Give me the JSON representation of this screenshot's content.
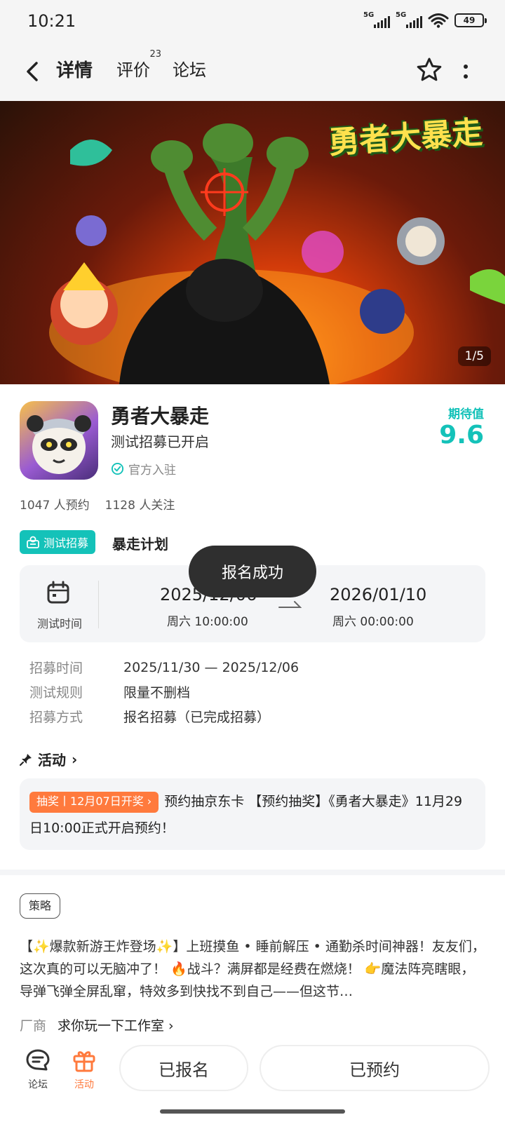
{
  "status_bar": {
    "time": "10:21",
    "sim1": "5G",
    "sim2": "5G",
    "battery": "49"
  },
  "nav": {
    "tab_detail": "详情",
    "tab_review": "评价",
    "review_count": "23",
    "tab_forum": "论坛"
  },
  "banner": {
    "logo_text": "勇者大暴走",
    "counter": "1/5"
  },
  "app": {
    "title": "勇者大暴走",
    "subtitle": "测试招募已开启",
    "verified": "官方入驻",
    "expect_label": "期待值",
    "expect_value": "9.6",
    "reservations": "1047 人预约",
    "followers": "1128 人关注"
  },
  "test": {
    "tag": "测试招募",
    "plan": "暴走计划",
    "time_label": "测试时间",
    "start_date": "2025/12/06",
    "start_day": "周六  10:00:00",
    "end_date": "2026/01/10",
    "end_day": "周六  00:00:00",
    "rows": [
      {
        "key": "招募时间",
        "value": "2025/11/30 — 2025/12/06"
      },
      {
        "key": "测试规则",
        "value": "限量不删档"
      },
      {
        "key": "招募方式",
        "value": "报名招募（已完成招募）"
      }
    ]
  },
  "toast": "报名成功",
  "activity": {
    "header": "活动",
    "badge": "抽奖丨12月07日开奖 ›",
    "text": "预约抽京东卡 【预约抽奖】《勇者大暴走》11月29日10:00正式开启预约！"
  },
  "strategy_tag": "策略",
  "description": "【✨爆款新游王炸登场✨】上班摸鱼 • 睡前解压 • 通勤杀时间神器！友友们，这次真的可以无脑冲了！ 🔥战斗？满屏都是经费在燃烧！ 👉魔法阵亮瞎眼，导弹飞弹全屏乱窜，特效多到快找不到自己——但这节…",
  "vendor": {
    "key": "厂商",
    "value": "求你玩一下工作室 ›"
  },
  "bottom": {
    "forum": "论坛",
    "activity": "活动",
    "signed": "已报名",
    "reserved": "已预约"
  },
  "colors": {
    "accent": "#14c2b9",
    "orange": "#ff7a3d",
    "toast_bg": "#2f2f2f"
  }
}
